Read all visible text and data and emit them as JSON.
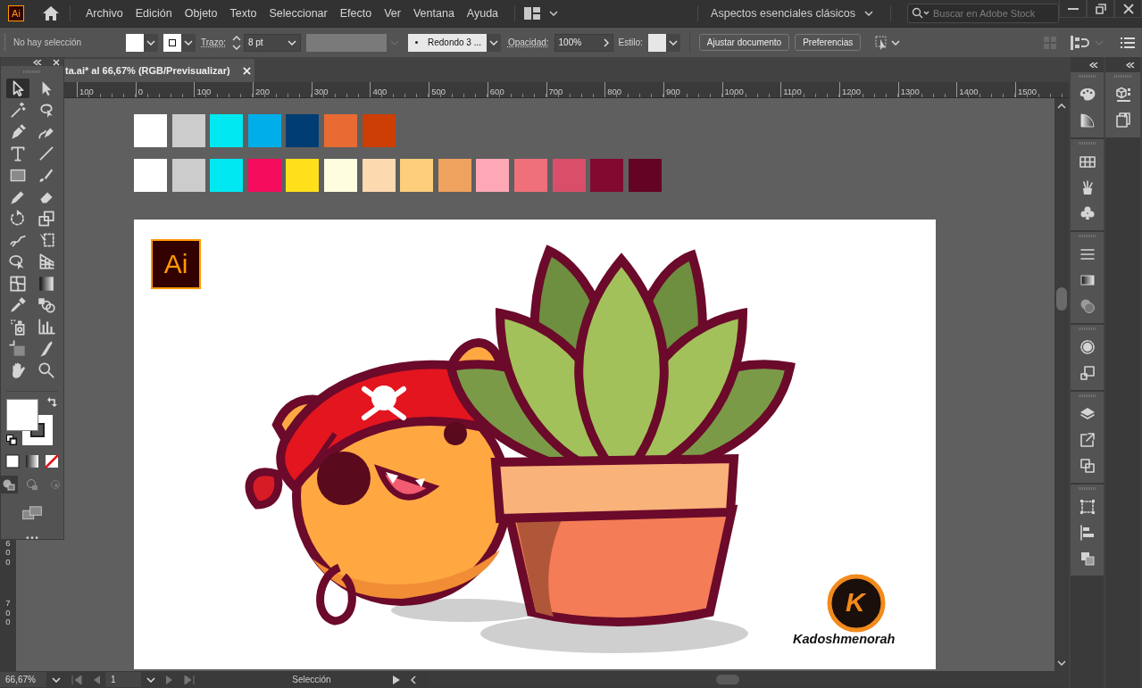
{
  "app_logo": "Ai",
  "menu": [
    "Archivo",
    "Edición",
    "Objeto",
    "Texto",
    "Seleccionar",
    "Efecto",
    "Ver",
    "Ventana",
    "Ayuda"
  ],
  "workspace": "Aspectos esenciales clásicos",
  "stock_search": {
    "placeholder": "Buscar en Adobe Stock"
  },
  "control_bar": {
    "selection": "No hay selección",
    "stroke_label": "Trazo:",
    "stroke_weight": "8 pt",
    "brush": "Redondo 3 ...",
    "opacity_label": "Opacidad:",
    "opacity": "100%",
    "style_label": "Estilo:",
    "buttons": [
      "Ajustar documento",
      "Preferencias"
    ]
  },
  "document_tab": {
    "title": "ta.ai* al 66,67% (RGB/Previsualizar)"
  },
  "ruler": {
    "horizontal": [
      "100",
      "0",
      "100",
      "200",
      "300",
      "400",
      "500",
      "600",
      "700",
      "800",
      "900",
      "1000",
      "1100",
      "1200",
      "1300",
      "1400",
      "1500"
    ],
    "vertical": [
      "600",
      "700"
    ]
  },
  "tools": [
    {
      "selected": true
    },
    {
      "selected": false
    },
    {
      "selected": false
    },
    {
      "selected": false
    },
    {
      "selected": false
    },
    {
      "selected": false
    },
    {
      "selected": false
    },
    {
      "selected": false
    },
    {
      "selected": false
    },
    {
      "selected": false
    },
    {
      "selected": false
    },
    {
      "selected": false
    },
    {
      "selected": false
    },
    {
      "selected": false
    },
    {
      "selected": false
    },
    {
      "selected": false
    },
    {
      "selected": false
    },
    {
      "selected": false
    },
    {
      "selected": false
    },
    {
      "selected": false
    },
    {
      "selected": false
    },
    {
      "selected": false
    },
    {
      "selected": false
    },
    {
      "selected": false
    },
    {
      "selected": false
    },
    {
      "selected": false
    },
    {
      "selected": false
    },
    {
      "selected": false
    }
  ],
  "swatch_rows": [
    [
      {
        "color": "#ffffff"
      },
      {
        "color": "#cccccc"
      },
      {
        "color": "#00e8f2"
      },
      {
        "color": "#00aeea"
      },
      {
        "color": "#003d73"
      },
      {
        "color": "#e86b33"
      },
      {
        "color": "#cc3e04"
      }
    ],
    [
      {
        "color": "#ffffff"
      },
      {
        "color": "#cccccc"
      },
      {
        "color": "#00e8f2"
      },
      {
        "color": "#f50c5c"
      },
      {
        "color": "#ffe01a"
      },
      {
        "color": "#fffde0"
      },
      {
        "color": "#fdd9b0"
      },
      {
        "color": "#fece7c"
      },
      {
        "color": "#efa25d"
      },
      {
        "color": "#fea8b6"
      },
      {
        "color": "#ef6f7b"
      },
      {
        "color": "#d94f69"
      },
      {
        "color": "#820a30"
      },
      {
        "color": "#650325"
      }
    ]
  ],
  "artboard": {
    "badge": "Ai",
    "logo_letter": "K",
    "signature": "Kadoshmenorah"
  },
  "status_bar": {
    "zoom": "66,67%",
    "artboard": "1",
    "tool": "Selección"
  }
}
